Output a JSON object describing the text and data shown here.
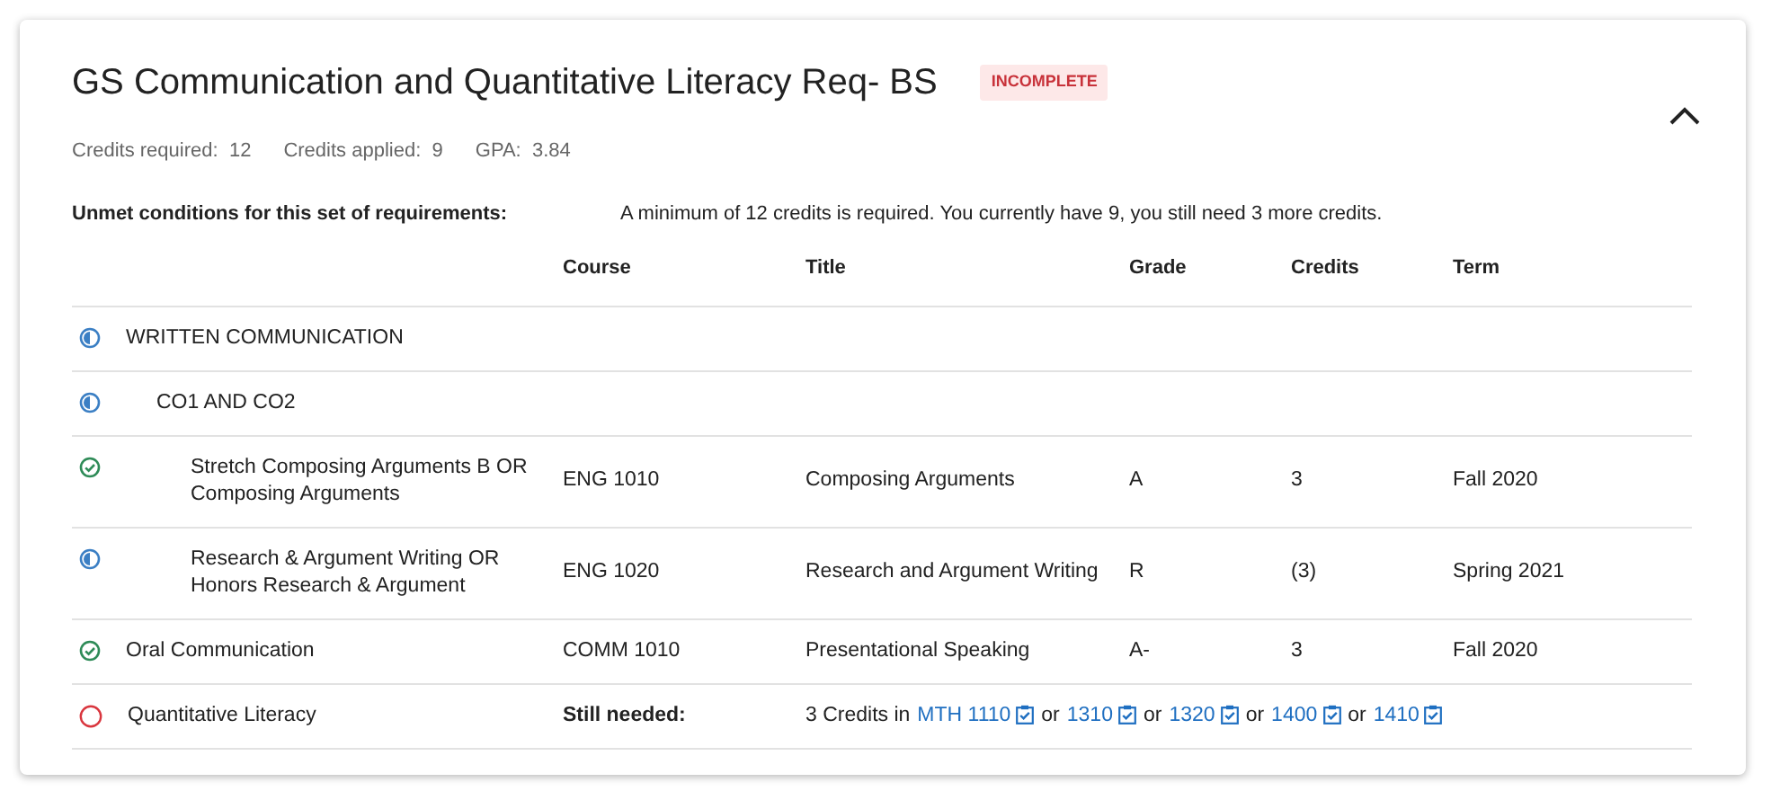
{
  "title": "GS Communication and Quantitative Literacy Req- BS",
  "status_badge": "INCOMPLETE",
  "expanded": true,
  "stats": [
    {
      "label": "Credits required:",
      "value": "12"
    },
    {
      "label": "Credits applied:",
      "value": "9"
    },
    {
      "label": "GPA:",
      "value": "3.84"
    }
  ],
  "unmet": {
    "label": "Unmet conditions for this set of requirements:",
    "message": "A minimum of 12 credits is required. You currently have 9, you still need 3 more credits."
  },
  "columns": [
    "Course",
    "Title",
    "Grade",
    "Credits",
    "Term"
  ],
  "rows": [
    {
      "kind": "partial",
      "name": "WRITTEN COMMUNICATION",
      "children": [
        {
          "kind": "partial",
          "name": "CO1 AND CO2",
          "children": [
            {
              "kind": "complete",
              "name": "Stretch Composing Arguments B OR Composing Arguments",
              "course": "ENG 1010",
              "title": "Composing Arguments",
              "grade": "A",
              "credits": "3",
              "term": "Fall 2020"
            },
            {
              "kind": "partial",
              "name": "Research & Argument Writing OR Honors Research & Argument",
              "course": "ENG 1020",
              "title": "Research and Argument Writing",
              "grade": "R",
              "credits": "(3)",
              "term": "Spring 2021"
            }
          ]
        }
      ]
    },
    {
      "kind": "complete",
      "name": "Oral Communication",
      "course": "COMM 1010",
      "title": "Presentational Speaking",
      "grade": "A-",
      "credits": "3",
      "term": "Fall 2020"
    },
    {
      "kind": "missing",
      "name": "Quantitative Literacy",
      "still_needed": {
        "label": "Still needed:",
        "prefix": "3 Credits in",
        "links": [
          {
            "text": "MTH 1110"
          },
          {
            "joiner": "or",
            "text": "1310"
          },
          {
            "joiner": "or",
            "text": "1320"
          },
          {
            "joiner": "or",
            "text": "1400"
          },
          {
            "joiner": "or",
            "text": "1410"
          }
        ]
      }
    }
  ]
}
